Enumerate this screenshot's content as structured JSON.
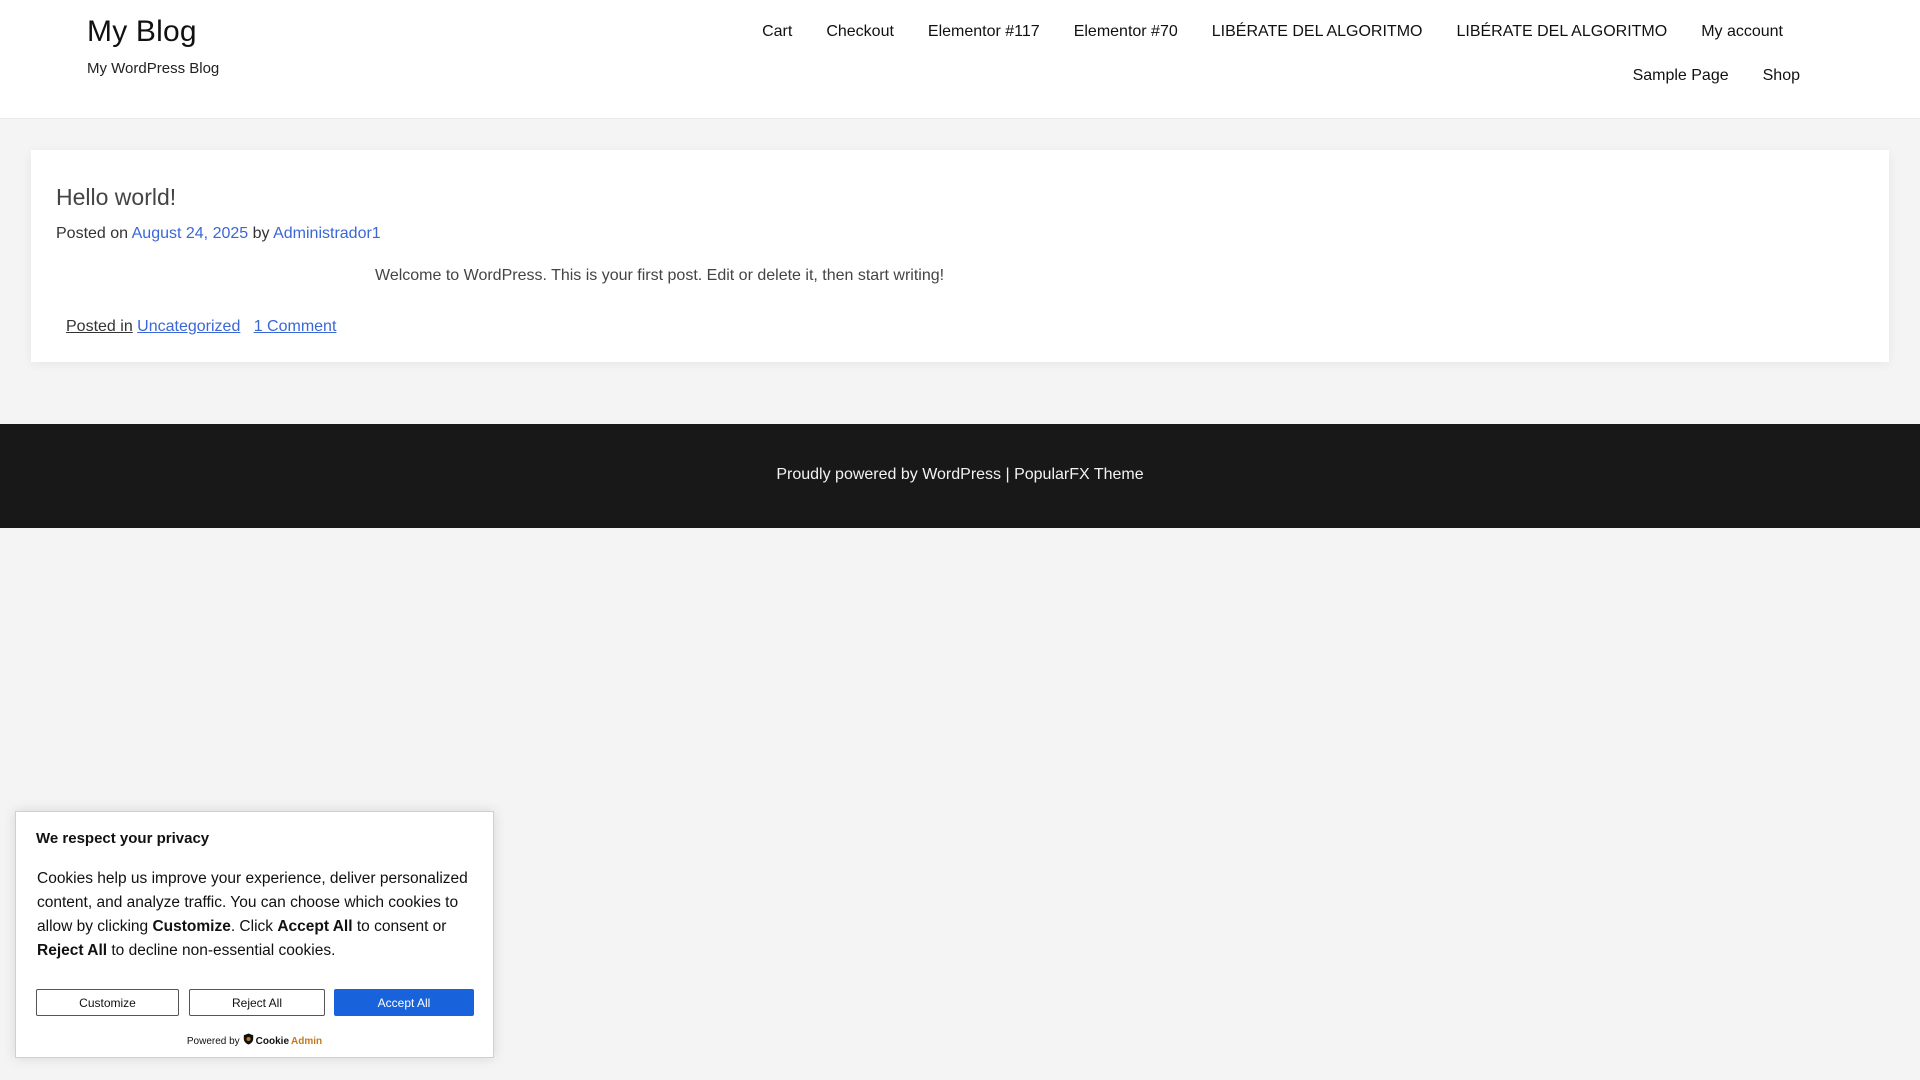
{
  "header": {
    "site_title": "My Blog",
    "site_description": "My WordPress Blog",
    "nav": [
      "Cart",
      "Checkout",
      "Elementor #117",
      "Elementor #70",
      "LIBÉRATE DEL ALGORITMO",
      "LIBÉRATE DEL ALGORITMO",
      "My account",
      "Sample Page",
      "Shop"
    ]
  },
  "post": {
    "title": "Hello world!",
    "meta_prefix": "Posted on",
    "date": "August 24, 2025",
    "meta_by": "by",
    "author": "Administrador1",
    "content": "Welcome to WordPress. This is your first post. Edit or delete it, then start writing!",
    "posted_in_label": "Posted in",
    "category": "Uncategorized",
    "comments": "1 Comment"
  },
  "footer": {
    "text": "Proudly powered by WordPress | PopularFX Theme"
  },
  "cookie_banner": {
    "title": "We respect your privacy",
    "text_1": "Cookies help us improve your experience, deliver personalized content, and analyze traffic. You can choose which cookies to allow by clicking ",
    "bold_customize": "Customize",
    "text_2": ". Click ",
    "bold_accept": "Accept All",
    "text_3": " to consent or ",
    "bold_reject": "Reject All",
    "text_4": " to decline non-essential cookies.",
    "customize_label": "Customize",
    "reject_label": "Reject All",
    "accept_label": "Accept All",
    "powered_by": "Powered by",
    "brand_cookie": "Cookie",
    "brand_admin": "Admin",
    "accent_color": "#1863dc",
    "brand_icon": "shield-icon"
  },
  "colors": {
    "link": "#3a67d6",
    "footer_bg": "#181818",
    "page_bg": "#f4f4f4"
  }
}
